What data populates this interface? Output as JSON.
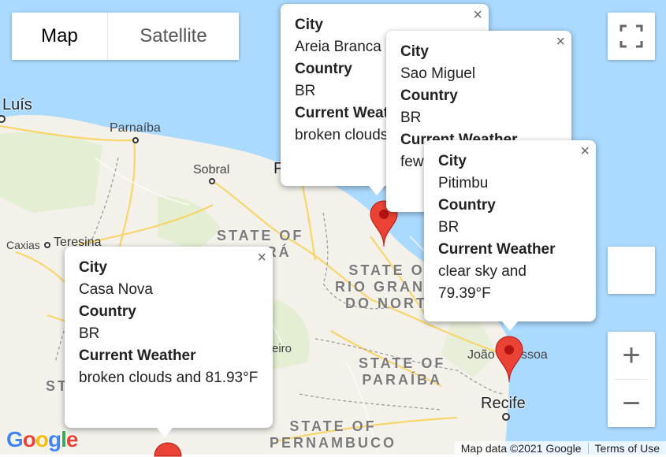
{
  "map_type": {
    "map_label": "Map",
    "satellite_label": "Satellite",
    "selected": "Map"
  },
  "colors": {
    "ocean": "#aadaff",
    "land": "#f3f1ea",
    "road": "#f8d56a",
    "marker": "#ea4335",
    "marker_dot": "#b31412",
    "state_border": "#9e9e9e"
  },
  "places": {
    "luis": "Luís",
    "parnaiba": "Parnaíba",
    "sobral": "Sobral",
    "fortaleza_partial": "F",
    "teresina": "Teresina",
    "caxias": "Caxias",
    "joao_pessoa_partial_1": "João",
    "joao_pessoa_partial_2": "ssoa",
    "recife": "Recife",
    "state_ceara": "STATE OF\nCEARÁ",
    "state_rio_grande": "STATE OF\nRIO GRANDE\nDO NORTE",
    "state_paraiba": "STATE OF\nPARAÍBA",
    "state_pernambuco": "STATE OF\nPERNAMBUCO",
    "partial_st": "ST",
    "partial_eiro": "eiro"
  },
  "info_windows": [
    {
      "city_label": "City",
      "city": "Areia Branca",
      "country_label": "Country",
      "country": "BR",
      "weather_label": "Current Weat",
      "weather": "broken clouds"
    },
    {
      "city_label": "City",
      "city": "Sao Miguel",
      "country_label": "Country",
      "country": "BR",
      "weather_label": "Current Weather",
      "weather": "few"
    },
    {
      "city_label": "City",
      "city": "Pitimbu",
      "country_label": "Country",
      "country": "BR",
      "weather_label": "Current Weather",
      "weather": "clear sky and 79.39°F"
    },
    {
      "city_label": "City",
      "city": "Casa Nova",
      "country_label": "Country",
      "country": "BR",
      "weather_label": "Current Weather",
      "weather": "broken clouds and 81.93°F"
    }
  ],
  "close_glyph": "×",
  "zoom": {
    "in": "+",
    "out": "−"
  },
  "footer": {
    "map_data": "Map data ©2021 Google",
    "terms": "Terms of Use"
  },
  "logo": {
    "letters": [
      "G",
      "o",
      "o",
      "g",
      "l",
      "e"
    ],
    "colors": [
      "#4285f4",
      "#ea4335",
      "#fbbc05",
      "#4285f4",
      "#34a853",
      "#ea4335"
    ]
  }
}
